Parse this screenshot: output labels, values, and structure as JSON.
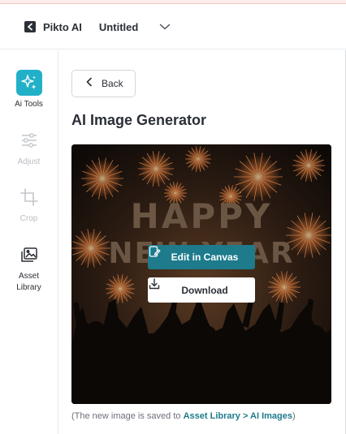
{
  "header": {
    "brand": "Pikto AI",
    "document_title": "Untitled"
  },
  "sidebar": {
    "items": [
      {
        "label": "Ai Tools",
        "icon": "sparkles-icon",
        "state": "active"
      },
      {
        "label": "Adjust",
        "icon": "sliders-icon",
        "state": "disabled"
      },
      {
        "label": "Crop",
        "icon": "crop-icon",
        "state": "disabled"
      },
      {
        "label": "Asset Library",
        "icon": "image-icon",
        "state": "normal"
      }
    ]
  },
  "panel": {
    "back_label": "Back",
    "title": "AI Image Generator",
    "image_text_line1": "HAPPY",
    "image_text_line2": "NEW YEAR",
    "edit_label": "Edit in Canvas",
    "download_label": "Download",
    "note_prefix": "(The new image is saved to ",
    "note_link": "Asset Library > AI Images",
    "note_suffix": ")"
  },
  "colors": {
    "accent": "#22b0c8",
    "edit_button": "#1d7b8c",
    "link": "#1d7b8c"
  }
}
